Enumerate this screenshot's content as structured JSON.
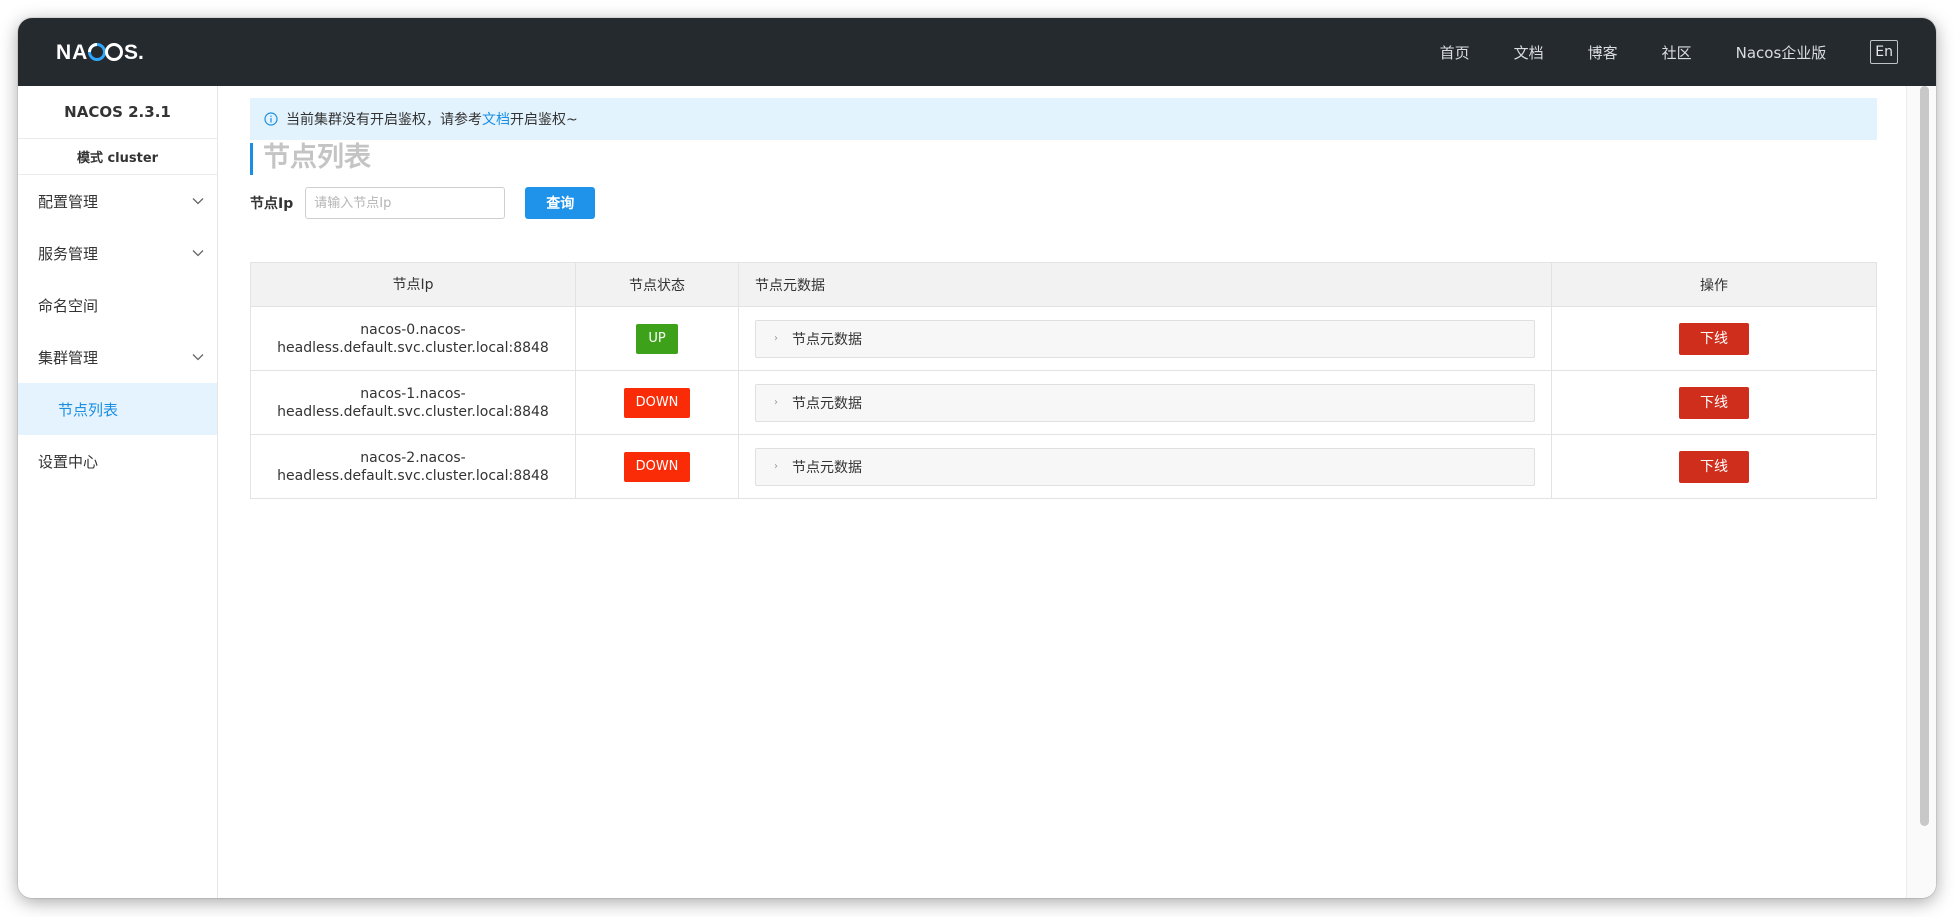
{
  "header": {
    "logo_text": "NACOS.",
    "nav": [
      "首页",
      "文档",
      "博客",
      "社区",
      "Nacos企业版"
    ],
    "lang_button": "En"
  },
  "sidebar": {
    "version": "NACOS 2.3.1",
    "mode": "模式 cluster",
    "items": [
      {
        "label": "配置管理",
        "expandable": true
      },
      {
        "label": "服务管理",
        "expandable": true
      },
      {
        "label": "命名空间",
        "expandable": false
      },
      {
        "label": "集群管理",
        "expandable": true
      },
      {
        "label": "节点列表",
        "sub": true,
        "active": true
      },
      {
        "label": "设置中心",
        "expandable": false
      }
    ]
  },
  "notice": {
    "prefix": "当前集群没有开启鉴权，请参考",
    "link": "文档",
    "suffix": "开启鉴权~"
  },
  "page_title": "节点列表",
  "filter": {
    "label": "节点Ip",
    "placeholder": "请输入节点Ip",
    "value": "",
    "button": "查询"
  },
  "table": {
    "headers": [
      "节点Ip",
      "节点状态",
      "节点元数据",
      "操作"
    ],
    "rows": [
      {
        "ip_line1": "nacos-0.nacos-",
        "ip_line2": "headless.default.svc.cluster.local:8848",
        "state": "UP",
        "meta": "节点元数据",
        "action": "下线"
      },
      {
        "ip_line1": "nacos-1.nacos-",
        "ip_line2": "headless.default.svc.cluster.local:8848",
        "state": "DOWN",
        "meta": "节点元数据",
        "action": "下线"
      },
      {
        "ip_line1": "nacos-2.nacos-",
        "ip_line2": "headless.default.svc.cluster.local:8848",
        "state": "DOWN",
        "meta": "节点元数据",
        "action": "下线"
      }
    ]
  },
  "colors": {
    "header_bg": "#252a2f",
    "accent": "#1a8ee2",
    "up": "#3ea11a",
    "down": "#fa2b07",
    "offline": "#d02e1d"
  }
}
